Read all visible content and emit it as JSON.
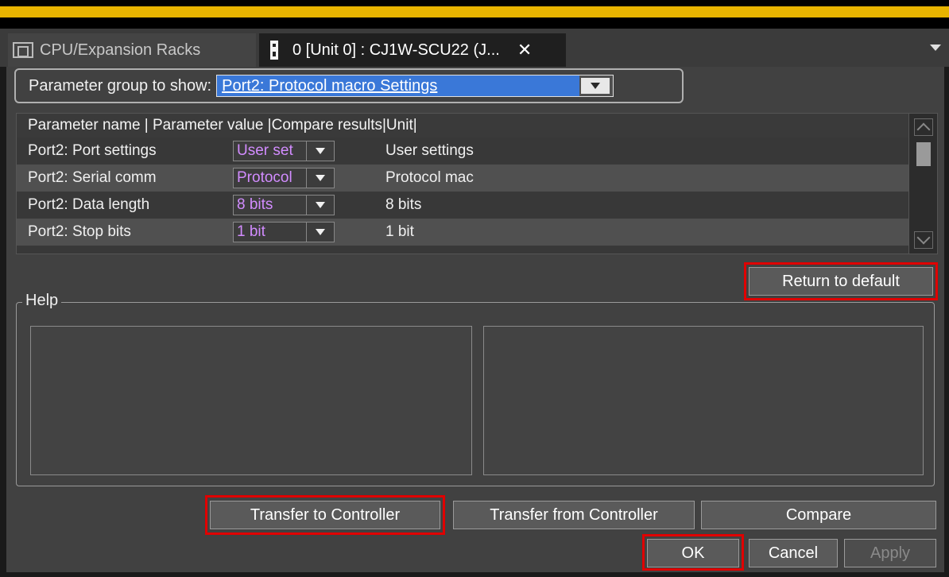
{
  "tabs": [
    {
      "label": "CPU/Expansion Racks",
      "icon": "rack-icon"
    },
    {
      "label": "0 [Unit 0] : CJ1W-SCU22 (J...",
      "icon": "unit-icon"
    }
  ],
  "parameter_group": {
    "label": "Parameter group to show:",
    "selected": "Port2: Protocol macro Settings"
  },
  "table": {
    "header": "Parameter name   | Parameter value |Compare results|Unit|",
    "rows": [
      {
        "name": "Port2: Port settings",
        "value": "User set",
        "compare": "User settings"
      },
      {
        "name": "Port2: Serial comm",
        "value": "Protocol",
        "compare": "Protocol mac"
      },
      {
        "name": "Port2: Data length",
        "value": "8 bits",
        "compare": "8 bits"
      },
      {
        "name": "Port2: Stop bits",
        "value": "1 bit",
        "compare": "1 bit"
      }
    ]
  },
  "buttons": {
    "return_default": "Return to default",
    "transfer_to": "Transfer to Controller",
    "transfer_from": "Transfer from Controller",
    "compare": "Compare",
    "ok": "OK",
    "cancel": "Cancel",
    "apply": "Apply"
  },
  "help": {
    "legend": "Help"
  },
  "colors": {
    "accent": "#e8b400",
    "highlight": "#e00000",
    "value_text": "#d28cff",
    "selection": "#3a78d8"
  }
}
